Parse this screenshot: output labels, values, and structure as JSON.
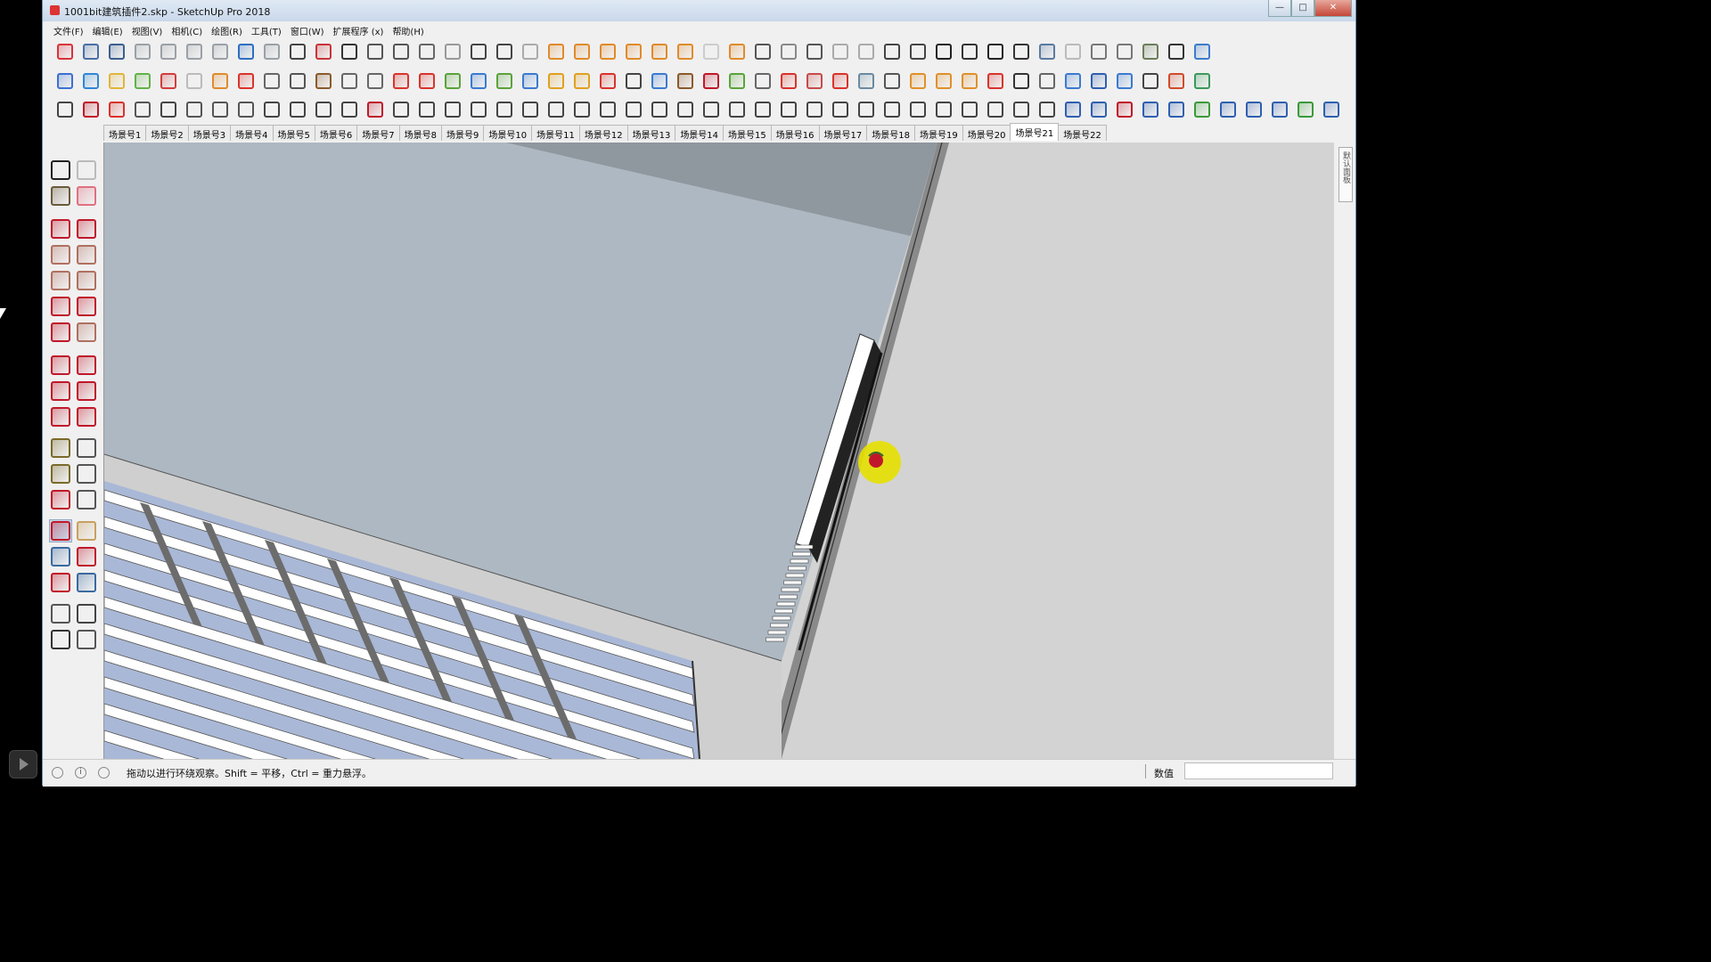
{
  "window": {
    "title": "1001bit建筑插件2.skp - SketchUp Pro 2018",
    "controls": {
      "minimize": "—",
      "maximize": "□",
      "close": "✕"
    }
  },
  "menu": [
    "文件(F)",
    "编辑(E)",
    "视图(V)",
    "相机(C)",
    "绘图(R)",
    "工具(T)",
    "窗口(W)",
    "扩展程序 (x)",
    "帮助(H)"
  ],
  "toolbar_row1_icons": [
    {
      "name": "new-icon",
      "color": "#d9333b"
    },
    {
      "name": "open-icon",
      "color": "#4a6fa5"
    },
    {
      "name": "save-icon",
      "color": "#3b5f8f"
    },
    {
      "name": "cut-icon",
      "color": "#9aa0a6"
    },
    {
      "name": "copy-icon",
      "color": "#9aa0a6"
    },
    {
      "name": "paste-icon",
      "color": "#9aa0a6"
    },
    {
      "name": "erase-icon",
      "color": "#9aa0a6"
    },
    {
      "name": "undo-icon",
      "color": "#2e6fc0"
    },
    {
      "name": "redo-icon",
      "color": "#9aa0a6"
    },
    {
      "name": "print-icon",
      "color": "#444"
    },
    {
      "name": "model-info-icon",
      "color": "#c8343a"
    },
    {
      "name": "validate-icon",
      "color": "#333"
    },
    {
      "name": "teapot-icon",
      "color": "#555"
    },
    {
      "name": "hand-icon",
      "color": "#555"
    },
    {
      "name": "align-icon",
      "color": "#666"
    },
    {
      "name": "frame-icon",
      "color": "#999"
    },
    {
      "name": "window-icon",
      "color": "#444"
    },
    {
      "name": "panel-icon",
      "color": "#444"
    },
    {
      "name": "lock-icon",
      "color": "#aaa"
    },
    {
      "name": "cone-icon",
      "color": "#e08a2c"
    },
    {
      "name": "circle-icon",
      "color": "#e08a2c"
    },
    {
      "name": "angle-icon",
      "color": "#e08a2c"
    },
    {
      "name": "stake-icon",
      "color": "#e08a2c"
    },
    {
      "name": "burst-icon",
      "color": "#e08a2c"
    },
    {
      "name": "dome-icon",
      "color": "#e08a2c"
    },
    {
      "name": "sphere-icon",
      "color": "#ccc"
    },
    {
      "name": "sun-icon",
      "color": "#e08a2c"
    },
    {
      "name": "car-icon",
      "color": "#555"
    },
    {
      "name": "box-icon",
      "color": "#888"
    },
    {
      "name": "box-open-icon",
      "color": "#555"
    },
    {
      "name": "plant-icon",
      "color": "#aaa"
    },
    {
      "name": "stamp-icon",
      "color": "#aaa"
    },
    {
      "name": "house-a-icon",
      "color": "#444"
    },
    {
      "name": "book-icon",
      "color": "#444"
    },
    {
      "name": "home-icon",
      "color": "#222"
    },
    {
      "name": "shop-icon",
      "color": "#333"
    },
    {
      "name": "home-outline-icon",
      "color": "#222"
    },
    {
      "name": "store-icon",
      "color": "#333"
    },
    {
      "name": "style-1-icon",
      "color": "#5a7aa0"
    },
    {
      "name": "style-2-icon",
      "color": "#bbb"
    },
    {
      "name": "style-3-icon",
      "color": "#777"
    },
    {
      "name": "style-4-icon",
      "color": "#777"
    },
    {
      "name": "style-5-icon",
      "color": "#6c7e5a"
    },
    {
      "name": "style-6-icon",
      "color": "#333"
    },
    {
      "name": "style-7-icon",
      "color": "#3c7cc9"
    }
  ],
  "toolbar_row2_icons": [
    {
      "name": "paint-blue-icon",
      "color": "#3b70d0"
    },
    {
      "name": "layer-blue-icon",
      "color": "#2f86d6"
    },
    {
      "name": "layer-yellow-icon",
      "color": "#e0b53a"
    },
    {
      "name": "layer-green-icon",
      "color": "#62b248"
    },
    {
      "name": "layer-red-icon",
      "color": "#d23c3c"
    },
    {
      "name": "layer-outline-icon",
      "color": "#bbb"
    },
    {
      "name": "rotate-orange-icon",
      "color": "#e08a2c"
    },
    {
      "name": "square-red-icon",
      "color": "#d9332b"
    },
    {
      "name": "grid-icon",
      "color": "#666"
    },
    {
      "name": "flag-icon",
      "color": "#555"
    },
    {
      "name": "book-brown-icon",
      "color": "#8a5a2b"
    },
    {
      "name": "link-icon",
      "color": "#666"
    },
    {
      "name": "curve-icon",
      "color": "#666"
    },
    {
      "name": "points-red-icon",
      "color": "#d9332b"
    },
    {
      "name": "cross-red-icon",
      "color": "#d9332b"
    },
    {
      "name": "move-green-icon",
      "color": "#5aa33a"
    },
    {
      "name": "move-blue-icon",
      "color": "#3a7ad0"
    },
    {
      "name": "cone-green-icon",
      "color": "#5aa33a"
    },
    {
      "name": "tree-icon",
      "color": "#3a7ad0"
    },
    {
      "name": "warning-icon",
      "color": "#e0a020"
    },
    {
      "name": "hook-icon",
      "color": "#e0a020"
    },
    {
      "name": "hook-red-icon",
      "color": "#d9332b"
    },
    {
      "name": "cycle-icon",
      "color": "#444"
    },
    {
      "name": "star-icon",
      "color": "#3a7ad0"
    },
    {
      "name": "trash-icon",
      "color": "#8a5a2b"
    },
    {
      "name": "undo-red-icon",
      "color": "#c0182a"
    },
    {
      "name": "stairs-green-icon",
      "color": "#5aa33a"
    },
    {
      "name": "stairs-icon",
      "color": "#666"
    },
    {
      "name": "stairs-red-icon",
      "color": "#d9332b"
    },
    {
      "name": "cubes-icon",
      "color": "#c84a4a"
    },
    {
      "name": "target-red-icon",
      "color": "#d9332b"
    },
    {
      "name": "palette-icon",
      "color": "#6a8aa0"
    },
    {
      "name": "bridge-icon",
      "color": "#555"
    },
    {
      "name": "grid-orange-icon",
      "color": "#e0902a"
    },
    {
      "name": "grid-orange-2-icon",
      "color": "#e0902a"
    },
    {
      "name": "grid-orange-3-icon",
      "color": "#e0902a"
    },
    {
      "name": "close-red-icon",
      "color": "#d9332b"
    },
    {
      "name": "arc-points-icon",
      "color": "#333"
    },
    {
      "name": "grid-small-icon",
      "color": "#666"
    },
    {
      "name": "shield-icon",
      "color": "#3a7ad0"
    },
    {
      "name": "shield-blue-icon",
      "color": "#2f5fb0"
    },
    {
      "name": "shield-outline-icon",
      "color": "#3a7ad0"
    },
    {
      "name": "hood-icon",
      "color": "#444"
    },
    {
      "name": "pie-icon",
      "color": "#d04a2a"
    },
    {
      "name": "sheets-icon",
      "color": "#3a9a5a"
    }
  ],
  "toolbar_row3_icons": [
    {
      "name": "polyline-icon",
      "color": "#444"
    },
    {
      "name": "points-chain-icon",
      "color": "#c0182a"
    },
    {
      "name": "eraser-red-icon",
      "color": "#d9332b"
    },
    {
      "name": "split-icon",
      "color": "#555"
    },
    {
      "name": "gear-icon",
      "color": "#444"
    },
    {
      "name": "offset-icon",
      "color": "#555"
    },
    {
      "name": "bend-icon",
      "color": "#555"
    },
    {
      "name": "cube-frame-icon",
      "color": "#555"
    },
    {
      "name": "cube-mesh-icon",
      "color": "#444"
    },
    {
      "name": "arrow-bend-icon",
      "color": "#444"
    },
    {
      "name": "angle-line-icon",
      "color": "#444"
    },
    {
      "name": "angle-line-2-icon",
      "color": "#444"
    },
    {
      "name": "slash-red-icon",
      "color": "#c0182a"
    },
    {
      "name": "fillet-icon",
      "color": "#444"
    },
    {
      "name": "arch-icon",
      "color": "#444"
    },
    {
      "name": "tent-icon",
      "color": "#444"
    },
    {
      "name": "column-icon",
      "color": "#444"
    },
    {
      "name": "comb-icon",
      "color": "#444"
    },
    {
      "name": "dome-grid-icon",
      "color": "#444"
    },
    {
      "name": "leaf-icon",
      "color": "#444"
    },
    {
      "name": "fan-icon",
      "color": "#444"
    },
    {
      "name": "waves-icon",
      "color": "#444"
    },
    {
      "name": "ramp-icon",
      "color": "#444"
    },
    {
      "name": "stairs-line-icon",
      "color": "#444"
    },
    {
      "name": "stairs-line-2-icon",
      "color": "#444"
    },
    {
      "name": "stairs-line-3-icon",
      "color": "#444"
    },
    {
      "name": "building-icon",
      "color": "#444"
    },
    {
      "name": "hatch-icon",
      "color": "#444"
    },
    {
      "name": "stair-spiral-icon",
      "color": "#444"
    },
    {
      "name": "stair-flag-icon",
      "color": "#444"
    },
    {
      "name": "ladder-icon",
      "color": "#444"
    },
    {
      "name": "roof-icon",
      "color": "#444"
    },
    {
      "name": "roof-2-icon",
      "color": "#444"
    },
    {
      "name": "fence-icon",
      "color": "#444"
    },
    {
      "name": "sphere-grid-icon",
      "color": "#444"
    },
    {
      "name": "screw-icon",
      "color": "#444"
    },
    {
      "name": "wedge-icon",
      "color": "#444"
    },
    {
      "name": "truss-icon",
      "color": "#444"
    },
    {
      "name": "hex-icon",
      "color": "#444"
    },
    {
      "name": "arc-bridge-icon",
      "color": "#2f5fb0"
    },
    {
      "name": "zigzag-icon",
      "color": "#2f5fb0"
    },
    {
      "name": "zigzag-red-icon",
      "color": "#c0182a"
    },
    {
      "name": "n-curve-icon",
      "color": "#2f5fb0"
    },
    {
      "name": "bracket-icon",
      "color": "#2f5fb0"
    },
    {
      "name": "arc-green-icon",
      "color": "#3a9a3a"
    },
    {
      "name": "rounded-rect-icon",
      "color": "#2f5fb0"
    },
    {
      "name": "spiral-icon",
      "color": "#2f5fb0"
    },
    {
      "name": "arc-blue-icon",
      "color": "#2f5fb0"
    },
    {
      "name": "wave-green-icon",
      "color": "#3a9a3a"
    },
    {
      "name": "hook-blue-icon",
      "color": "#2f5fb0"
    }
  ],
  "scene_tabs": [
    "场景号1",
    "场景号2",
    "场景号3",
    "场景号4",
    "场景号5",
    "场景号6",
    "场景号7",
    "场景号8",
    "场景号9",
    "场景号10",
    "场景号11",
    "场景号12",
    "场景号13",
    "场景号14",
    "场景号15",
    "场景号16",
    "场景号17",
    "场景号18",
    "场景号19",
    "场景号20",
    "场景号21",
    "场景号22"
  ],
  "active_scene_index": 20,
  "left_tools": [
    {
      "name": "select-icon",
      "color": "#222"
    },
    {
      "name": "component-icon",
      "color": "#bbb"
    },
    {
      "name": "paint-bucket-icon",
      "color": "#6a5a3a"
    },
    {
      "name": "eraser-icon",
      "color": "#e07080"
    },
    {
      "name": "pencil-icon",
      "color": "#c0182a"
    },
    {
      "name": "freehand-icon",
      "color": "#c0182a"
    },
    {
      "name": "rectangle-icon",
      "color": "#b07060"
    },
    {
      "name": "rotated-rect-icon",
      "color": "#b07060"
    },
    {
      "name": "circle-tool-icon",
      "color": "#b07060"
    },
    {
      "name": "polygon-icon",
      "color": "#b07060"
    },
    {
      "name": "arc-tool-icon",
      "color": "#c0182a"
    },
    {
      "name": "pie-tool-icon",
      "color": "#c0182a"
    },
    {
      "name": "arc-3pt-icon",
      "color": "#c0182a"
    },
    {
      "name": "arc-2pt-icon",
      "color": "#b07060"
    },
    {
      "name": "move-tool-icon",
      "color": "#c0182a"
    },
    {
      "name": "push-pull-icon",
      "color": "#c0182a"
    },
    {
      "name": "rotate-tool-icon",
      "color": "#c0182a"
    },
    {
      "name": "follow-me-icon",
      "color": "#c0182a"
    },
    {
      "name": "scale-tool-icon",
      "color": "#c0182a"
    },
    {
      "name": "offset-tool-icon",
      "color": "#c0182a"
    },
    {
      "name": "tape-measure-icon",
      "color": "#7a6a2a"
    },
    {
      "name": "dimension-icon",
      "color": "#555"
    },
    {
      "name": "protractor-icon",
      "color": "#7a6a2a"
    },
    {
      "name": "text-tool-icon",
      "color": "#555"
    },
    {
      "name": "axes-icon",
      "color": "#c0182a"
    },
    {
      "name": "3d-text-icon",
      "color": "#555"
    },
    {
      "name": "orbit-icon",
      "color": "#c0182a"
    },
    {
      "name": "pan-icon",
      "color": "#c8a060"
    },
    {
      "name": "zoom-icon",
      "color": "#3a6aa0"
    },
    {
      "name": "zoom-window-icon",
      "color": "#c0182a"
    },
    {
      "name": "zoom-extents-icon",
      "color": "#c0182a"
    },
    {
      "name": "previous-view-icon",
      "color": "#3a6aa0"
    },
    {
      "name": "position-camera-icon",
      "color": "#555"
    },
    {
      "name": "look-around-icon",
      "color": "#444"
    },
    {
      "name": "walk-icon",
      "color": "#333"
    },
    {
      "name": "section-plane-icon",
      "color": "#555"
    }
  ],
  "right_tray_label": "默认面板",
  "status": {
    "hint": "拖动以进行环绕观察。Shift = 平移，Ctrl = 重力悬浮。",
    "measurements_label": "数值",
    "measurements_value": ""
  },
  "orbit_cursor_color": "#e6e000"
}
